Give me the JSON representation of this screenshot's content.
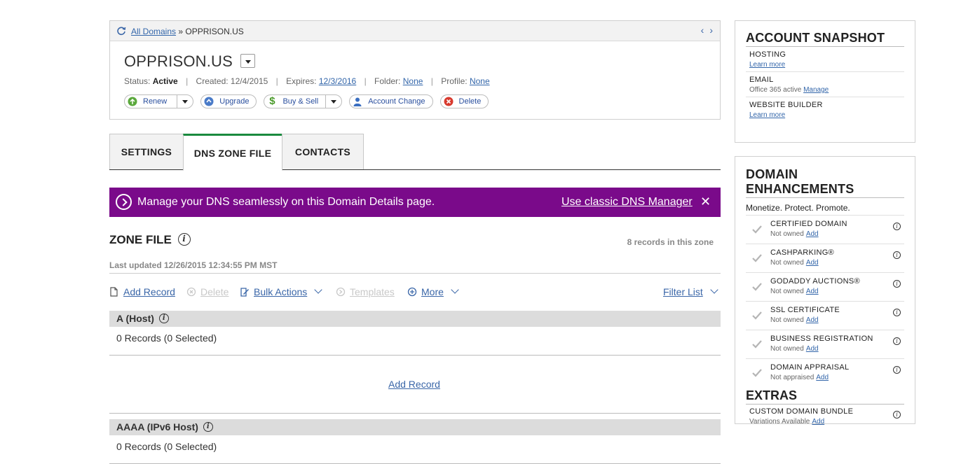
{
  "breadcrumb": {
    "link": "All Domains",
    "separator": "»",
    "current": "OPPRISON.US"
  },
  "domain": {
    "name": "OPPRISON.US",
    "status_label": "Status:",
    "status": "Active",
    "created_label": "Created:",
    "created": "12/4/2015",
    "expires_label": "Expires:",
    "expires": "12/3/2016",
    "folder_label": "Folder:",
    "folder": "None",
    "profile_label": "Profile:",
    "profile": "None"
  },
  "actions": {
    "renew": "Renew",
    "upgrade": "Upgrade",
    "buy_sell": "Buy & Sell",
    "account_change": "Account Change",
    "delete": "Delete"
  },
  "tabs": [
    {
      "label": "SETTINGS",
      "active": false
    },
    {
      "label": "DNS ZONE FILE",
      "active": true
    },
    {
      "label": "CONTACTS",
      "active": false
    }
  ],
  "banner": {
    "message": "Manage your DNS seamlessly on this Domain Details page.",
    "link": "Use classic DNS Manager",
    "close": "✕",
    "color": "#7a0a8a"
  },
  "zone": {
    "title": "ZONE FILE",
    "record_count": "8 records in this zone",
    "last_updated": "Last updated 12/26/2015 12:34:55 PM MST"
  },
  "toolbar": {
    "add_record": "Add Record",
    "delete": "Delete",
    "bulk_actions": "Bulk Actions",
    "templates": "Templates",
    "more": "More",
    "filter_list": "Filter List"
  },
  "sections": [
    {
      "title": "A (Host)",
      "records": "0 Records (0 Selected)",
      "add_record": "Add Record"
    },
    {
      "title": "AAAA (IPv6 Host)",
      "records": "0 Records (0 Selected)"
    }
  ],
  "account_snapshot": {
    "title": "ACCOUNT SNAPSHOT",
    "items": [
      {
        "label": "HOSTING",
        "text": "",
        "link": "Learn more"
      },
      {
        "label": "EMAIL",
        "text": "Office 365 active",
        "link": "Manage"
      },
      {
        "label": "WEBSITE BUILDER",
        "text": "",
        "link": "Learn more"
      }
    ]
  },
  "enhancements": {
    "title": "DOMAIN ENHANCEMENTS",
    "tagline": "Monetize. Protect. Promote.",
    "items": [
      {
        "label": "CERTIFIED DOMAIN",
        "status": "Not owned",
        "link": "Add"
      },
      {
        "label": "CASHPARKING®",
        "status": "Not owned",
        "link": "Add"
      },
      {
        "label": "GODADDY AUCTIONS®",
        "status": "Not owned",
        "link": "Add"
      },
      {
        "label": "SSL CERTIFICATE",
        "status": "Not owned",
        "link": "Add"
      },
      {
        "label": "BUSINESS REGISTRATION",
        "status": "Not owned",
        "link": "Add"
      },
      {
        "label": "DOMAIN APPRAISAL",
        "status": "Not appraised",
        "link": "Add"
      }
    ],
    "extras_title": "EXTRAS",
    "extras": [
      {
        "label": "CUSTOM DOMAIN BUNDLE",
        "status": "Variations Available",
        "link": "Add"
      }
    ]
  },
  "info_glyph": "i"
}
